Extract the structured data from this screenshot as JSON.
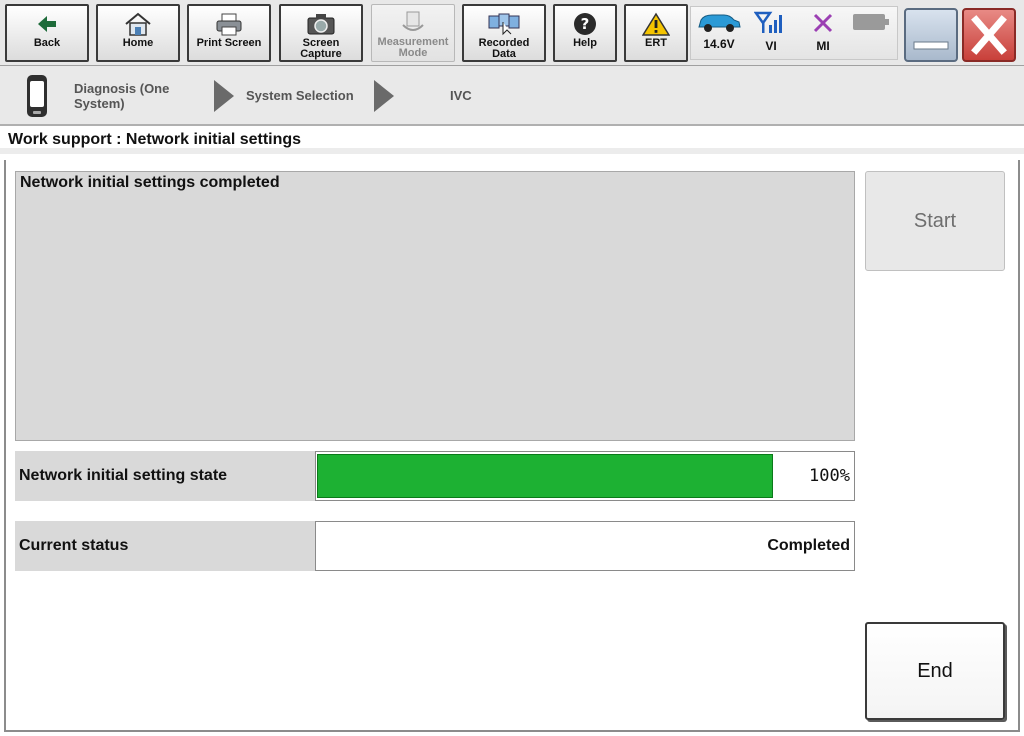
{
  "toolbar": {
    "buttons": [
      {
        "label": "Back",
        "icon": "back-arrow-icon"
      },
      {
        "label": "Home",
        "icon": "home-icon"
      },
      {
        "label": "Print Screen",
        "icon": "printer-icon"
      },
      {
        "label": "Screen\nCapture",
        "icon": "camera-icon"
      },
      {
        "label": "Measurement\nMode",
        "icon": "measurement-icon"
      },
      {
        "label": "Recorded\nData",
        "icon": "recorded-data-icon"
      },
      {
        "label": "Help",
        "icon": "help-icon"
      },
      {
        "label": "ERT",
        "icon": "warning-icon"
      }
    ],
    "status": {
      "voltage": "14.6V",
      "vi": "VI",
      "mi": "MI"
    }
  },
  "breadcrumb": {
    "items": [
      "Diagnosis (One\nSystem)",
      "System Selection",
      "IVC"
    ]
  },
  "page": {
    "title": "Work support : Network initial settings",
    "message": "Network initial settings completed",
    "progress_label": "Network initial setting state",
    "progress_percent": 100,
    "progress_text": "100%",
    "status_label": "Current status",
    "status_value": "Completed",
    "start_label": "Start",
    "end_label": "End"
  },
  "colors": {
    "progress": "#1db133",
    "close_button": "#d9534f",
    "signal": "#1f5fbf",
    "mi_cross": "#9b3fb3"
  }
}
